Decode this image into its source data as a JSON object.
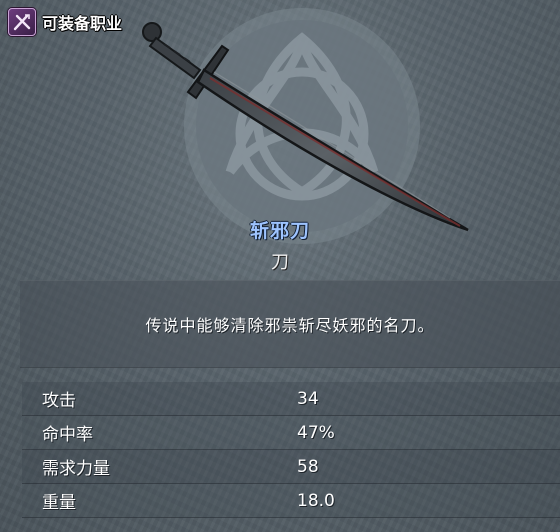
{
  "class_tag": {
    "label": "可装备职业",
    "icon": "crossed-weapons-icon"
  },
  "background": {
    "emblem": "triquetra-emblem"
  },
  "item": {
    "image": "sword-icon",
    "name": "斩邪刀",
    "type": "刀",
    "description": "传说中能够清除邪祟斩尽妖邪的名刀。"
  },
  "stats": [
    {
      "label": "攻击",
      "value": "34"
    },
    {
      "label": "命中率",
      "value": "47%"
    },
    {
      "label": "需求力量",
      "value": "58"
    },
    {
      "label": "重量",
      "value": "18.0"
    }
  ],
  "colors": {
    "name": "#9ec4ff",
    "text": "#ffffff",
    "panel": "#58636b",
    "class_icon": "#6d3c7e"
  }
}
